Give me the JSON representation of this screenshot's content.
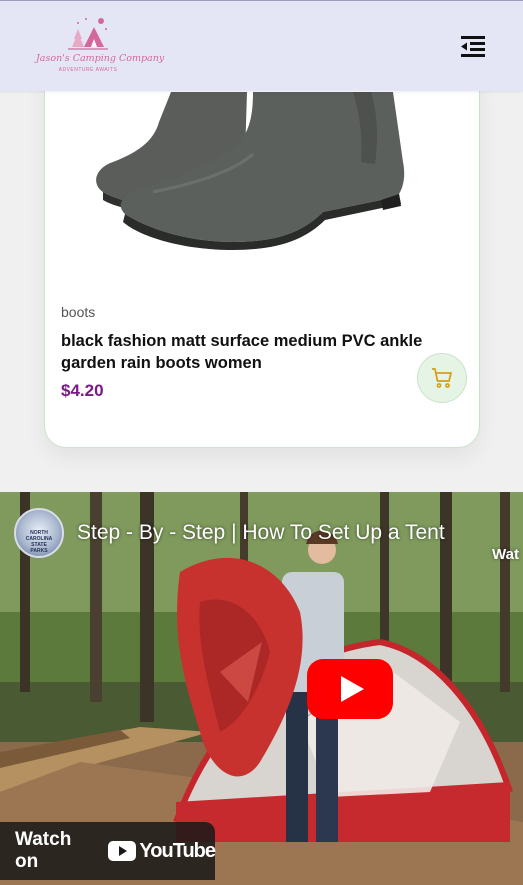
{
  "header": {
    "logo_name": "Jason's Camping Company",
    "logo_tagline": "ADVENTURE AWAITS",
    "menu_icon": "menu-collapse-icon"
  },
  "product": {
    "category": "boots",
    "title": "black fashion matt surface medium PVC ankle garden rain boots women",
    "price": "$4.20",
    "cart_icon": "shopping-cart-icon",
    "accent_color": "#7a1a86",
    "cart_color": "#d4a017"
  },
  "video": {
    "title": "Step - By - Step | How To Set Up a Tent",
    "channel_badge": "NORTH CAROLINA STATE PARKS",
    "watch_later_partial": "Wat",
    "watch_on_label": "Watch on",
    "platform_label": "YouTube",
    "play_icon": "youtube-play-icon",
    "play_color": "#ff0000"
  }
}
